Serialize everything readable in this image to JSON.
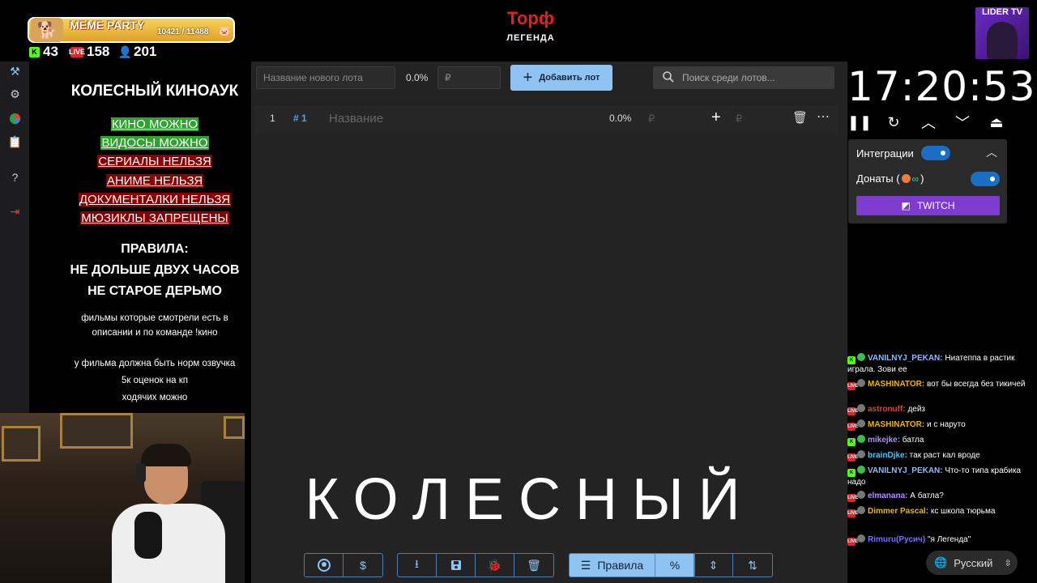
{
  "overlay": {
    "meme_title": "MEME PARTY",
    "meme_count": "10421 / 11488",
    "stats": {
      "kick": "43",
      "live": "158",
      "viewers": "201"
    },
    "brand_title": "Торф",
    "brand_sub": "ЛЕГЕНДА",
    "lider_label": "LIDER TV",
    "big_word": "КОЛЕСНЫЙ"
  },
  "rules": {
    "heading": "КОЛЕСНЫЙ КИНОАУК",
    "allowed": [
      "КИНО МОЖНО",
      "ВИДОСЫ МОЖНО"
    ],
    "denied": [
      "СЕРИАЛЫ НЕЛЬЗЯ",
      "АНИМЕ НЕЛЬЗЯ",
      "ДОКУМЕНТАЛКИ НЕЛЬЗЯ",
      "МЮЗИКЛЫ ЗАПРЕЩЕНЫ"
    ],
    "rules_title": "ПРАВИЛА:",
    "rule1": "НЕ ДОЛЬШЕ ДВУХ ЧАСОВ",
    "rule2": "НЕ СТАРОЕ ДЕРЬМО",
    "note1": "фильмы которые смотрели есть в описании и по команде !кино",
    "note2": "у фильма должна быть норм озвучка",
    "note3": "5к оценок на кп",
    "note4": "ходячих можно"
  },
  "toolbar": {
    "lot_name_placeholder": "Название нового лота",
    "percent": "0.0%",
    "currency": "₽",
    "add_label": "Добавить лот",
    "search_placeholder": "Поиск среди лотов..."
  },
  "lot": {
    "index": "1",
    "tag": "# 1",
    "name_placeholder": "Название",
    "percent": "0.0%",
    "currency": "₽"
  },
  "bottom": {
    "rules_label": "Правила"
  },
  "timer": {
    "time": "17:20:53"
  },
  "integrations": {
    "title": "Интеграции",
    "donations": "Донаты (",
    "donations_end": ")",
    "twitch": "TWITCH"
  },
  "chat": [
    {
      "user": "VANILNYJ_PEKAN:",
      "text": " Ниатеппа в растик играла. Зови ее",
      "platform": "kick",
      "color": "#8fb8ff"
    },
    {
      "user": "MASHINATOR:",
      "text": " вот бы всегда без тикичей",
      "platform": "live",
      "color": "#f0b400"
    },
    {
      "user": "astronuff:",
      "text": " дейз",
      "platform": "live",
      "color": "#e0442b"
    },
    {
      "user": "MASHINATOR:",
      "text": " и с наруто",
      "platform": "live",
      "color": "#f0b400"
    },
    {
      "user": "mikejke:",
      "text": " батла",
      "platform": "kick",
      "color": "#b48cff"
    },
    {
      "user": "brainDjke:",
      "text": " так раст кал вроде",
      "platform": "live",
      "color": "#4fc3f7"
    },
    {
      "user": "VANILNYJ_PEKAN:",
      "text": " Что-то типа крабика надо",
      "platform": "kick",
      "color": "#8fb8ff"
    },
    {
      "user": "elmanana:",
      "text": " А батла?",
      "platform": "live",
      "color": "#b48cff"
    },
    {
      "user": "Dimmer Pascal:",
      "text": " кс школа тюрьма",
      "platform": "live",
      "color": "#f0b400"
    },
    {
      "user": "Rimuru(Русич)",
      "text": " \"я Легенда\"",
      "platform": "live",
      "color": "#7a6cff"
    }
  ],
  "language": "Русский"
}
